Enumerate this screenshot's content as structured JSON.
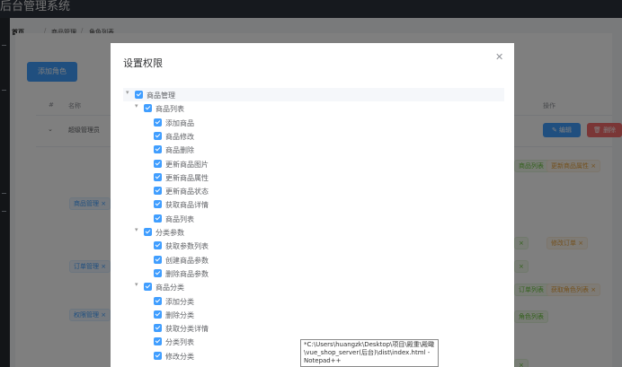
{
  "app": {
    "title": "后台管理系统"
  },
  "breadcrumb": [
    "首页",
    "商品管理",
    "角色列表"
  ],
  "toolbar": {
    "add_role_label": "添加角色"
  },
  "table": {
    "headers": [
      "#",
      "名称",
      "操作"
    ],
    "rows": [
      {
        "name": "超级管理员",
        "edit_label": "编辑",
        "delete_label": "删除"
      }
    ],
    "expanded_tags": {
      "level1": [
        "商品管理",
        "订单管理",
        "权限管理"
      ],
      "level2": [
        "商品列表",
        "订单列表",
        "角色列表"
      ],
      "level3": [
        "更新商品属性",
        "修改订单",
        "获取角色列表"
      ]
    }
  },
  "dialog": {
    "title": "设置权限",
    "tree": [
      {
        "label": "商品管理",
        "level": 0
      },
      {
        "label": "商品列表",
        "level": 1
      },
      {
        "label": "添加商品",
        "level": 2
      },
      {
        "label": "商品修改",
        "level": 2
      },
      {
        "label": "商品删除",
        "level": 2
      },
      {
        "label": "更新商品图片",
        "level": 2
      },
      {
        "label": "更新商品属性",
        "level": 2
      },
      {
        "label": "更新商品状态",
        "level": 2
      },
      {
        "label": "获取商品详情",
        "level": 2
      },
      {
        "label": "商品列表",
        "level": 2
      },
      {
        "label": "分类参数",
        "level": 1
      },
      {
        "label": "获取参数列表",
        "level": 2
      },
      {
        "label": "创建商品参数",
        "level": 2
      },
      {
        "label": "删除商品参数",
        "level": 2
      },
      {
        "label": "商品分类",
        "level": 1
      },
      {
        "label": "添加分类",
        "level": 2
      },
      {
        "label": "删除分类",
        "level": 2
      },
      {
        "label": "获取分类详情",
        "level": 2
      },
      {
        "label": "分类列表",
        "level": 2
      },
      {
        "label": "修改分类",
        "level": 2
      }
    ]
  },
  "tooltip": {
    "text": "*C:\\Users\\huangzk\\Desktop\\项目\\殿重\\殿瞰\\vue_shop_server(后台)\\dist\\index.html - Notepad++"
  },
  "colors": {
    "primary": "#409eff",
    "danger": "#f56c6c",
    "header": "#2c323d"
  }
}
